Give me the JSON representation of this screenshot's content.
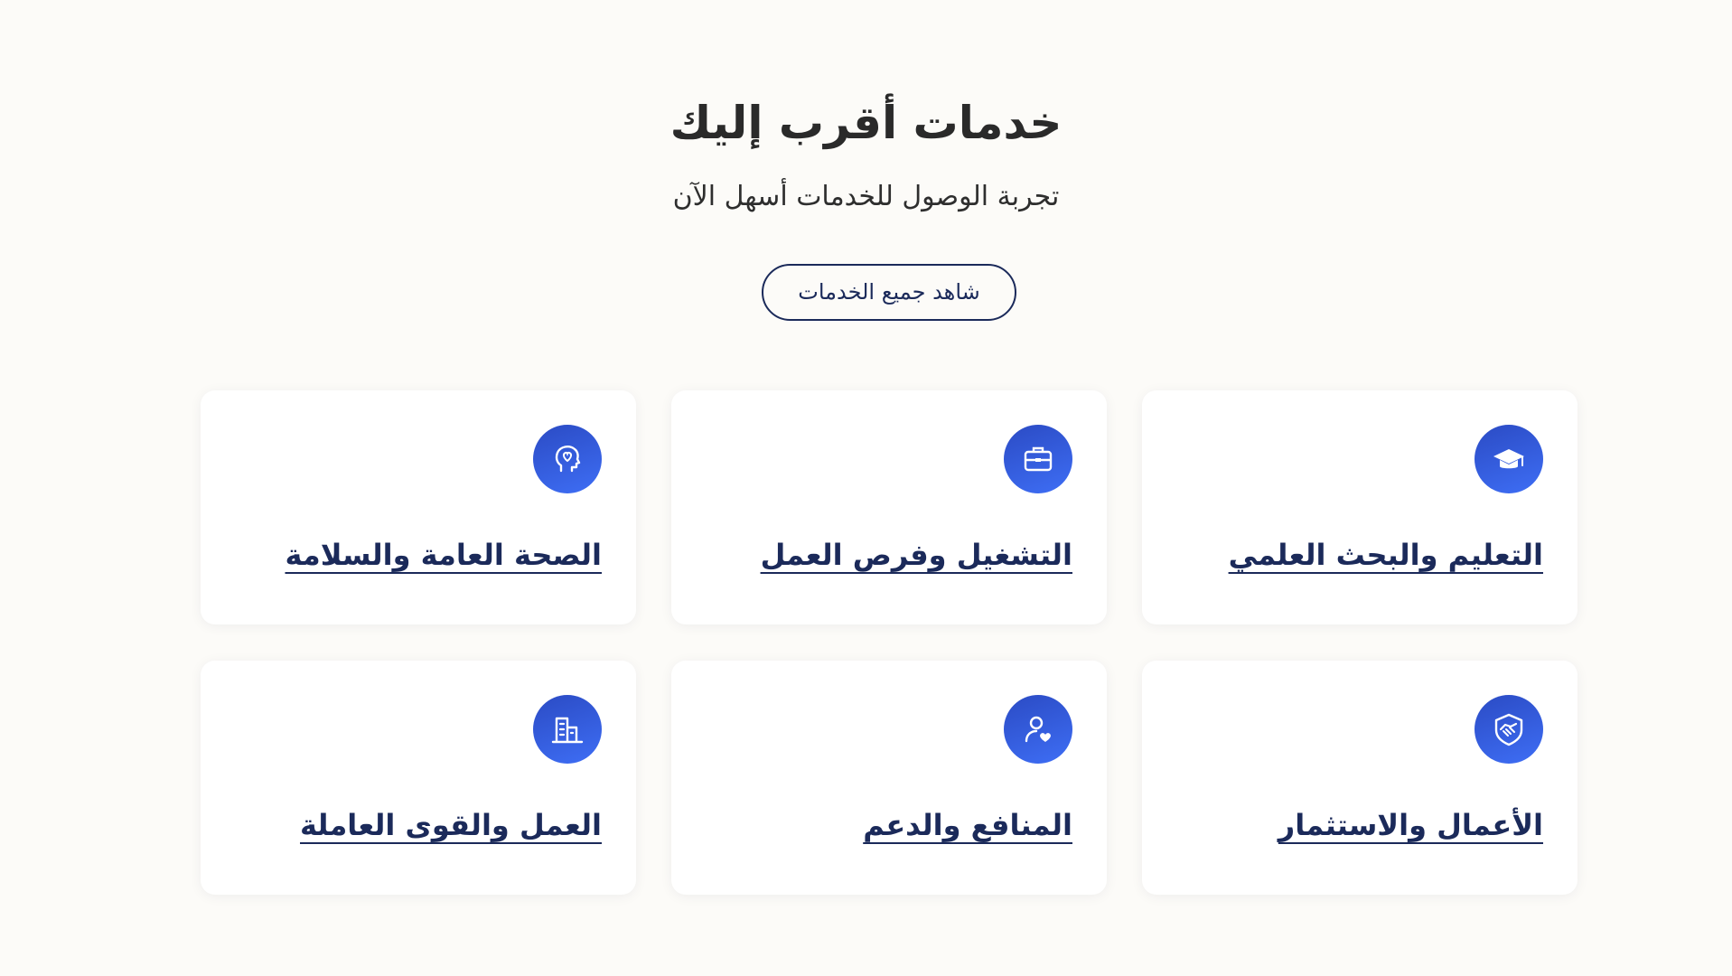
{
  "header": {
    "title": "خدمات أقرب إليك",
    "subtitle": "تجربة الوصول للخدمات أسهل الآن",
    "view_all_label": "شاهد جميع الخدمات"
  },
  "colors": {
    "background": "#fcfbf8",
    "title_text": "#2a2a2a",
    "accent_navy": "#1b2a5a",
    "icon_gradient_start": "#2b4bc4",
    "icon_gradient_end": "#3e6ef5",
    "card_background": "#ffffff"
  },
  "cards": [
    {
      "title": "التعليم والبحث العلمي",
      "icon": "graduation-cap-icon"
    },
    {
      "title": "التشغيل وفرص العمل",
      "icon": "briefcase-icon"
    },
    {
      "title": "الصحة العامة والسلامة",
      "icon": "head-heart-icon"
    },
    {
      "title": "الأعمال والاستثمار",
      "icon": "handshake-icon"
    },
    {
      "title": "المنافع والدعم",
      "icon": "person-heart-icon"
    },
    {
      "title": "العمل والقوى العاملة",
      "icon": "building-icon"
    }
  ]
}
